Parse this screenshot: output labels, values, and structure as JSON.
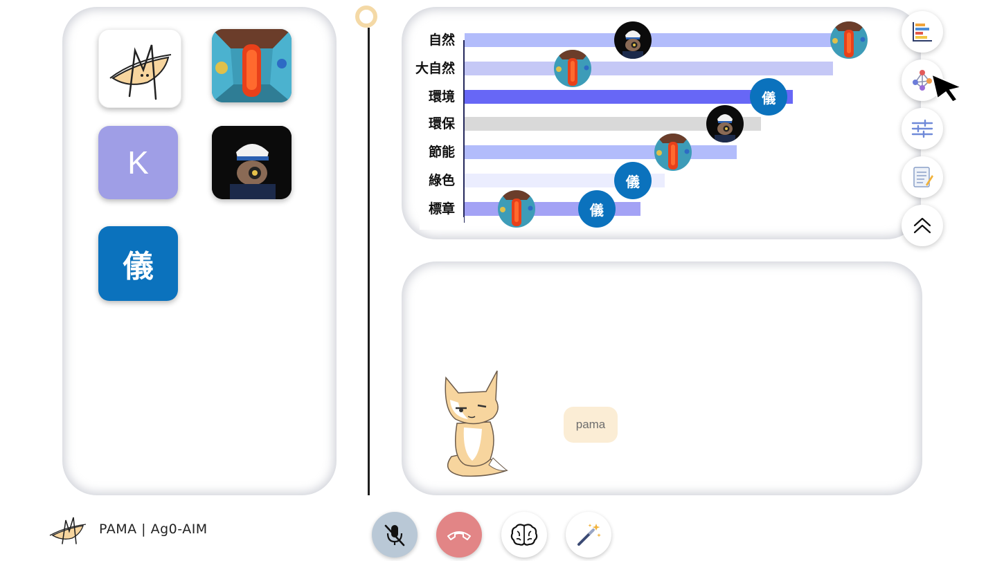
{
  "app": {
    "brand": "PAMA | Ag0-AIM"
  },
  "participants": [
    {
      "id": "pama",
      "kind": "logo"
    },
    {
      "id": "hallway",
      "kind": "photo"
    },
    {
      "id": "k",
      "kind": "letter",
      "letter": "K",
      "color": "#9f9ee6"
    },
    {
      "id": "camera-man",
      "kind": "photo"
    },
    {
      "id": "yi",
      "kind": "letter",
      "letter": "儀",
      "color": "#0b72bd"
    }
  ],
  "chart_data": {
    "type": "bar",
    "orientation": "horizontal",
    "categories": [
      "自然",
      "大自然",
      "環境",
      "環保",
      "節能",
      "綠色",
      "標章"
    ],
    "values": [
      100,
      92,
      82,
      74,
      68,
      50,
      44
    ],
    "bar_colors": [
      "#b2bcfb",
      "#c5c8f6",
      "#6767f6",
      "#d9d9d9",
      "#b2bcfb",
      "#ebedfe",
      "#a3a2f5"
    ],
    "markers": [
      {
        "category": "自然",
        "value": 42,
        "avatar": "camera-man"
      },
      {
        "category": "自然",
        "value": 96,
        "avatar": "hallway"
      },
      {
        "category": "大自然",
        "value": 27,
        "avatar": "hallway"
      },
      {
        "category": "環境",
        "value": 76,
        "avatar": "yi"
      },
      {
        "category": "環保",
        "value": 65,
        "avatar": "camera-man"
      },
      {
        "category": "節能",
        "value": 52,
        "avatar": "hallway"
      },
      {
        "category": "綠色",
        "value": 42,
        "avatar": "yi"
      },
      {
        "category": "標章",
        "value": 13,
        "avatar": "hallway"
      },
      {
        "category": "標章",
        "value": 33,
        "avatar": "yi"
      }
    ],
    "xlim": [
      0,
      100
    ],
    "grid": false,
    "legend": "none"
  },
  "toolbar": {
    "buttons": [
      {
        "name": "bar-chart",
        "icon": "bar-chart-icon"
      },
      {
        "name": "network",
        "icon": "network-graph-icon"
      },
      {
        "name": "settings",
        "icon": "sliders-icon"
      },
      {
        "name": "notes",
        "icon": "notepad-icon"
      },
      {
        "name": "collapse",
        "icon": "chevron-up-icon"
      }
    ]
  },
  "chat": {
    "message": "pama"
  },
  "controls": {
    "mic": {
      "icon": "mic-off-icon",
      "color": "#b9c8d6"
    },
    "hangup": {
      "icon": "phone-hangup-icon",
      "color": "#e28586"
    },
    "brain": {
      "icon": "brain-icon"
    },
    "magic": {
      "icon": "magic-wand-icon"
    }
  },
  "colors": {
    "accent": "#0b72bd",
    "timeline_ring": "#f4d9a6",
    "bubble": "#fbedd5"
  }
}
